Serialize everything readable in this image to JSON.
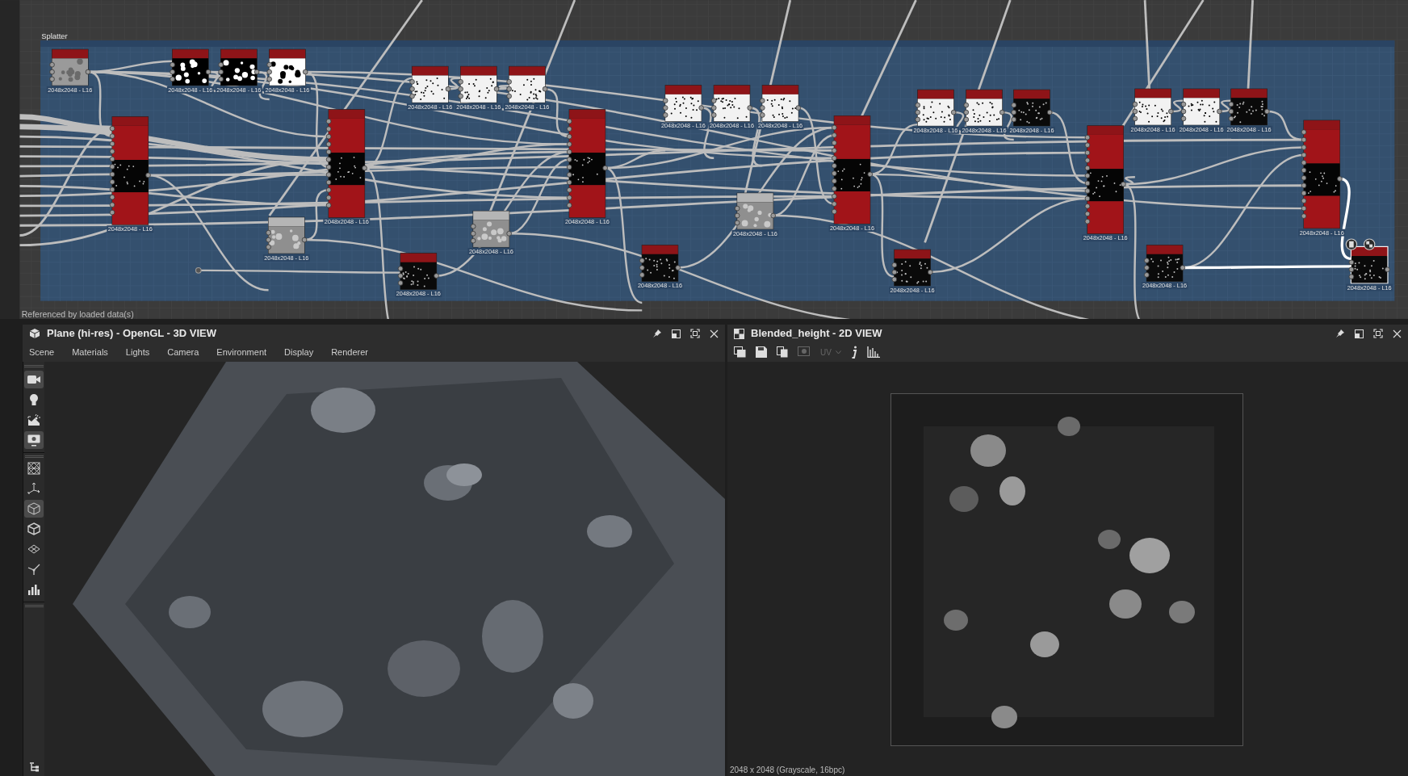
{
  "graph": {
    "frame_title": "Splatter",
    "nodes": [
      {
        "kind": "noise",
        "label": "2048x2048 - L16",
        "selected": false
      },
      {
        "kind": "white-dots",
        "label": "2048x2048 - L16",
        "selected": false
      },
      {
        "kind": "white-dots",
        "label": "2048x2048 - L16",
        "selected": false
      },
      {
        "kind": "black-dots",
        "label": "2048x2048 - L16",
        "selected": false
      },
      {
        "kind": "speckle",
        "label": "2048x2048 - L16",
        "selected": false
      },
      {
        "kind": "speckle",
        "label": "2048x2048 - L16",
        "selected": false
      },
      {
        "kind": "speckle",
        "label": "2048x2048 - L16",
        "selected": false
      },
      {
        "kind": "speckle",
        "label": "2048x2048 - L16",
        "selected": false
      },
      {
        "kind": "speckle",
        "label": "2048x2048 - L16",
        "selected": false
      },
      {
        "kind": "speckle",
        "label": "2048x2048 - L16",
        "selected": false
      },
      {
        "kind": "speckle",
        "label": "2048x2048 - L16",
        "selected": false
      },
      {
        "kind": "speckle",
        "label": "2048x2048 - L16",
        "selected": false
      },
      {
        "kind": "dark-speckle",
        "label": "2048x2048 - L16",
        "selected": false
      },
      {
        "kind": "speckle",
        "label": "2048x2048 - L16",
        "selected": false
      },
      {
        "kind": "speckle",
        "label": "2048x2048 - L16",
        "selected": false
      },
      {
        "kind": "dark-speckle",
        "label": "2048x2048 - L16",
        "selected": false
      },
      {
        "kind": "blend",
        "label": "2048x2048 - L16",
        "selected": false
      },
      {
        "kind": "blend",
        "label": "2048x2048 - L16",
        "selected": false
      },
      {
        "kind": "blend",
        "label": "2048x2048 - L16",
        "selected": false
      },
      {
        "kind": "blend",
        "label": "2048x2048 - L16",
        "selected": false
      },
      {
        "kind": "blend",
        "label": "2048x2048 - L16",
        "selected": false
      },
      {
        "kind": "blend",
        "label": "2048x2048 - L16",
        "selected": false
      },
      {
        "kind": "gray-noise",
        "label": "2048x2048 - L16",
        "selected": false
      },
      {
        "kind": "gray-noise",
        "label": "2048x2048 - L16",
        "selected": false
      },
      {
        "kind": "gray-noise",
        "label": "2048x2048 - L16",
        "selected": false
      },
      {
        "kind": "dark-speckle",
        "label": "2048x2048 - L16",
        "selected": false
      },
      {
        "kind": "dark-speckle",
        "label": "2048x2048 - L16",
        "selected": false
      },
      {
        "kind": "dark-speckle",
        "label": "2048x2048 - L16",
        "selected": false
      },
      {
        "kind": "dark-speckle",
        "label": "2048x2048 - L16",
        "selected": false
      },
      {
        "kind": "dark-speckle",
        "label": "2048x2048 - L16",
        "selected": true
      }
    ],
    "footer": "Referenced by loaded data(s)"
  },
  "view_3d": {
    "title": "Plane (hi-res) - OpenGL - 3D VIEW",
    "menu": [
      "Scene",
      "Materials",
      "Lights",
      "Camera",
      "Environment",
      "Display",
      "Renderer"
    ],
    "tools": [
      {
        "selected": true
      },
      {
        "selected": false
      },
      {
        "selected": false
      },
      {
        "selected": true
      },
      {
        "selected": false
      },
      {
        "selected": false
      },
      {
        "selected": true
      },
      {
        "selected": false
      },
      {
        "selected": false
      },
      {
        "selected": false
      },
      {
        "selected": false
      }
    ]
  },
  "view_2d": {
    "title": "Blended_height - 2D VIEW",
    "uv_label": "UV",
    "status": "2048 x 2048 (Grayscale, 16bpc)"
  }
}
